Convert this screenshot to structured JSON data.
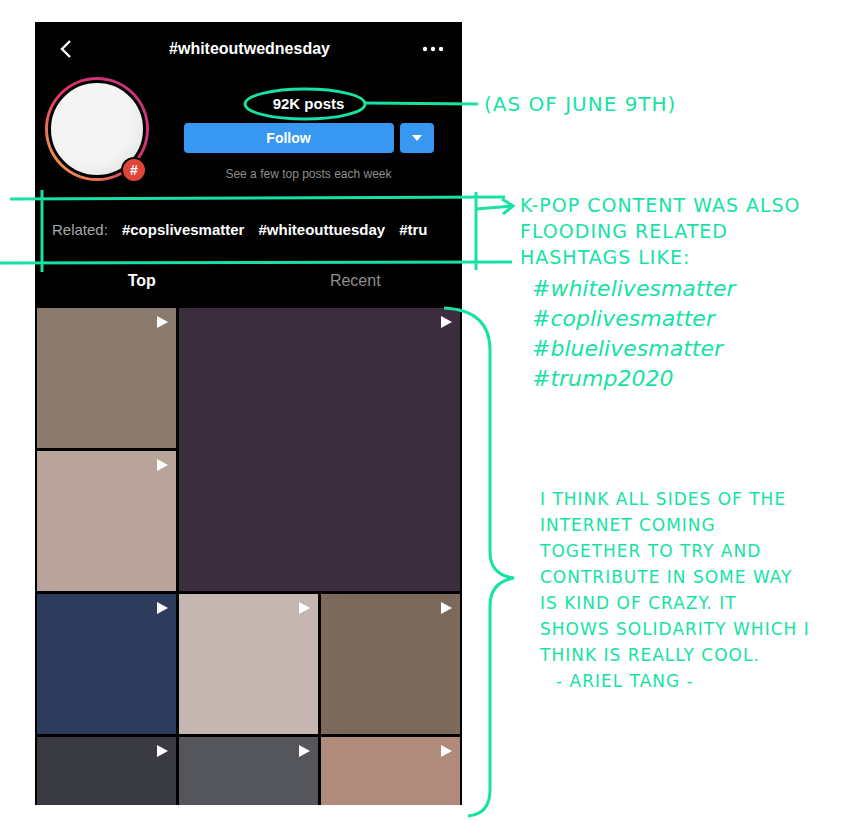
{
  "screen": {
    "header": {
      "title": "#whiteoutwednesday"
    },
    "profile": {
      "badge": "#",
      "posts": "92K posts",
      "follow": "Follow",
      "note": "See a few top posts each week"
    },
    "related": {
      "label": "Related:",
      "tags": [
        "#copslivesmatter",
        "#whiteouttuesday",
        "#tru"
      ]
    },
    "tabs": [
      {
        "label": "Top",
        "selected": true
      },
      {
        "label": "Recent",
        "selected": false
      }
    ],
    "tiles": [
      {
        "kind": "video",
        "color": "#8a7b6e"
      },
      {
        "kind": "video",
        "color": "#3b2c3e"
      },
      {
        "kind": "video",
        "color": "#b8a49a"
      },
      {
        "kind": "video",
        "color": "#2d3b5c"
      },
      {
        "kind": "video",
        "color": "#c6b6b2"
      },
      {
        "kind": "video",
        "color": "#7b6a5c"
      },
      {
        "kind": "video",
        "color": "#3a3a42"
      },
      {
        "kind": "video",
        "color": "#55565c"
      },
      {
        "kind": "video",
        "color": "#b08a7a"
      }
    ]
  },
  "annotations": {
    "posts_note": "(AS OF JUNE 9TH)",
    "related_note": "K-POP CONTENT WAS ALSO FLOODING RELATED HASHTAGS LIKE:",
    "hashtags": [
      "#whitelivesmatter",
      "#coplivesmatter",
      "#bluelivesmatter",
      "#trump2020"
    ],
    "quote": "I THINK ALL SIDES OF THE INTERNET COMING TOGETHER TO TRY AND CONTRIBUTE IN SOME WAY IS KIND OF CRAZY. IT SHOWS SOLIDARITY WHICH I THINK IS REALLY COOL.",
    "author": "- ARIEL TANG -"
  }
}
